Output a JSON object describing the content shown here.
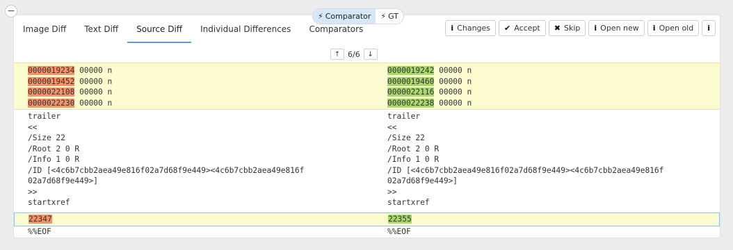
{
  "tabs": [
    "Image Diff",
    "Text Diff",
    "Source Diff",
    "Individual Differences",
    "Comparators"
  ],
  "active_tab": "Source Diff",
  "mode_switch": {
    "comparator": "Comparator",
    "gt": "GT"
  },
  "toolbar": {
    "changes": "Changes",
    "accept": "Accept",
    "skip": "Skip",
    "open_new": "Open new",
    "open_old": "Open old"
  },
  "nav": {
    "position": "6/6",
    "up": "↑",
    "down": "↓"
  },
  "hunk1": {
    "left": [
      {
        "hl": "0000019234",
        "rest": " 00000 n"
      },
      {
        "hl": "0000019452",
        "rest": " 00000 n"
      },
      {
        "hl": "0000022108",
        "rest": " 00000 n"
      },
      {
        "hl": "0000022230",
        "rest": " 00000 n"
      }
    ],
    "right": [
      {
        "hl": "0000019242",
        "rest": " 00000 n"
      },
      {
        "hl": "0000019460",
        "rest": " 00000 n"
      },
      {
        "hl": "0000022116",
        "rest": " 00000 n"
      },
      {
        "hl": "0000022238",
        "rest": " 00000 n"
      }
    ]
  },
  "context_lines": [
    "trailer",
    "<<",
    "/Size 22",
    "/Root 2 0 R",
    "/Info 1 0 R",
    "/ID [<4c6b7cbb2aea49e816f02a7d68f9e449><4c6b7cbb2aea49e816f",
    "02a7d68f9e449>]",
    ">>",
    "startxref"
  ],
  "hunk2": {
    "left": "22347",
    "right": "22355"
  },
  "tail_line": "%%EOF"
}
